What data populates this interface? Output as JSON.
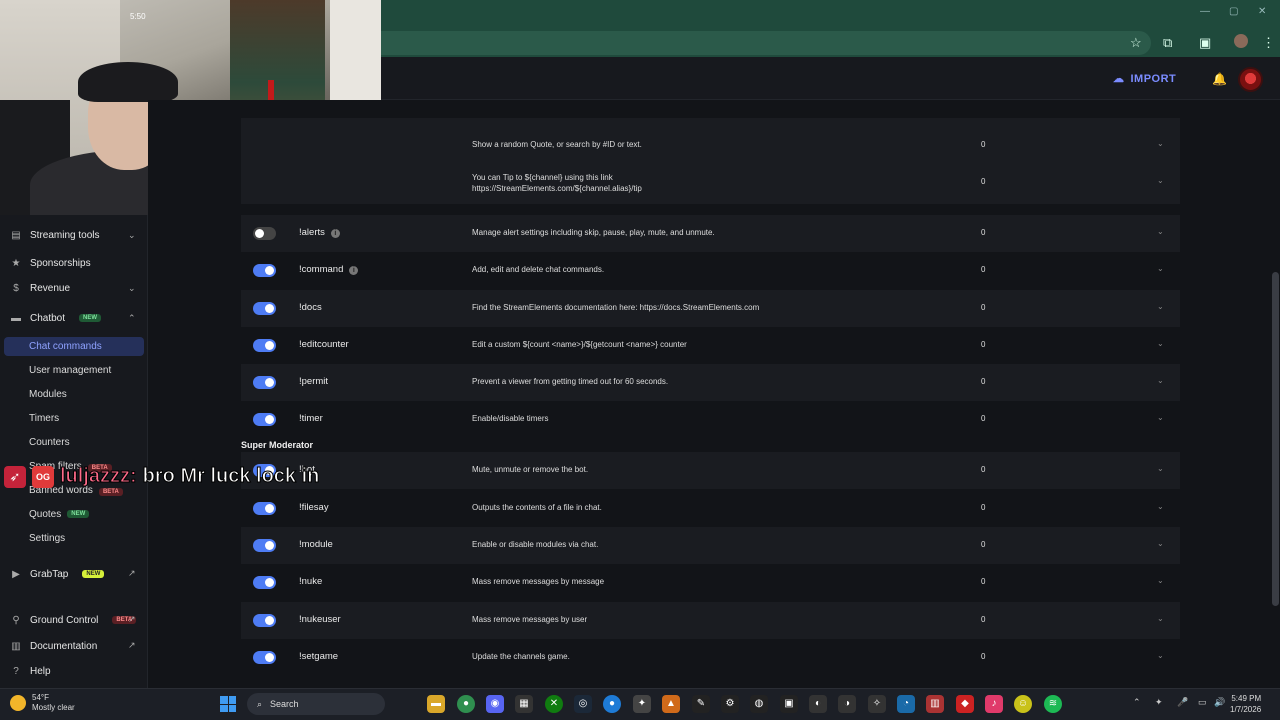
{
  "header": {
    "import_label": "IMPORT"
  },
  "webcam_label": "5:50",
  "sidebar": {
    "streaming_tools": "Streaming tools",
    "sponsorships": "Sponsorships",
    "revenue": "Revenue",
    "chatbot": "Chatbot",
    "chatbot_badge": "NEW",
    "sub_items": [
      "Chat commands",
      "User management",
      "Modules",
      "Timers",
      "Counters",
      "Spam filters",
      "Banned words",
      "Quotes",
      "Settings"
    ],
    "spam_badge": "BETA",
    "banned_badge": "BETA",
    "quotes_badge": "NEW",
    "grabtap": "GrabTap",
    "grabtap_badge": "NEW",
    "ground_control": "Ground Control",
    "ground_badge": "BETA",
    "documentation": "Documentation",
    "help": "Help"
  },
  "partial_rows": [
    {
      "desc": "Show a random Quote, or search by #ID or text.",
      "count": "0"
    },
    {
      "desc_line1": "You can Tip to ${channel} using this link",
      "desc_line2": "https://StreamElements.com/${channel.alias}/tip",
      "count": "0"
    }
  ],
  "rows": [
    {
      "cmd": "!alerts",
      "desc": "Manage alert settings including skip, pause, play, mute, and unmute.",
      "count": "0",
      "enabled": false,
      "info": true
    },
    {
      "cmd": "!command",
      "desc": "Add, edit and delete chat commands.",
      "count": "0",
      "enabled": true,
      "info": true
    },
    {
      "cmd": "!docs",
      "desc": "Find the StreamElements documentation here: https://docs.StreamElements.com",
      "count": "0",
      "enabled": true
    },
    {
      "cmd": "!editcounter",
      "desc": "Edit a custom ${count <name>}/${getcount <name>} counter",
      "count": "0",
      "enabled": true
    },
    {
      "cmd": "!permit",
      "desc": "Prevent a viewer from getting timed out for 60 seconds.",
      "count": "0",
      "enabled": true
    },
    {
      "cmd": "!timer",
      "desc": "Enable/disable timers",
      "count": "0",
      "enabled": true
    }
  ],
  "section_title": "Super Moderator",
  "mod_rows": [
    {
      "cmd": "!bot",
      "desc": "Mute, unmute or remove the bot.",
      "count": "0",
      "enabled": true
    },
    {
      "cmd": "!filesay",
      "desc": "Outputs the contents of a file in chat.",
      "count": "0",
      "enabled": true
    },
    {
      "cmd": "!module",
      "desc": "Enable or disable modules via chat.",
      "count": "0",
      "enabled": true
    },
    {
      "cmd": "!nuke",
      "desc": "Mass remove messages by message",
      "count": "0",
      "enabled": true
    },
    {
      "cmd": "!nukeuser",
      "desc": "Mass remove messages by user",
      "count": "0",
      "enabled": true
    },
    {
      "cmd": "!setgame",
      "desc": "Update the channels game.",
      "count": "0",
      "enabled": true
    }
  ],
  "chat_overlay": {
    "badge": "OG",
    "user": "luljazzz:",
    "message": "bro Mr luck lock in"
  },
  "taskbar": {
    "temp": "54°F",
    "weather": "Mostly clear",
    "search": "Search",
    "time": "5:49 PM",
    "date": "1/7/2026"
  }
}
